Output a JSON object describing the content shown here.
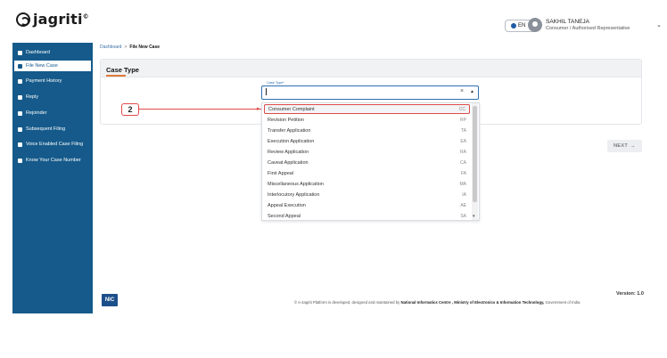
{
  "header": {
    "logo_text": "jagriti",
    "logo_sup": "©",
    "language": "EN",
    "user_name": "SAKHIL TANEJA",
    "user_role": "Consumer / Authorised Representative"
  },
  "sidebar": {
    "items": [
      {
        "label": "Dashboard",
        "icon": "grid-icon"
      },
      {
        "label": "File New Case",
        "icon": "file-icon"
      },
      {
        "label": "Payment History",
        "icon": "card-icon"
      },
      {
        "label": "Reply",
        "icon": "edit-icon"
      },
      {
        "label": "Rejoinder",
        "icon": "file-icon"
      },
      {
        "label": "Subsequent Filing",
        "icon": "file-icon"
      },
      {
        "label": "Voice Enabled Case Filing",
        "icon": "mic-icon"
      },
      {
        "label": "Know Your Case Number",
        "icon": "edit-icon"
      }
    ]
  },
  "breadcrumb": {
    "home": "Dashboard",
    "separator": ">",
    "current": "File New Case"
  },
  "card": {
    "title": "Case Type"
  },
  "select": {
    "label": "Case Type*",
    "value": "",
    "clear_symbol": "×",
    "arrow_symbol": "▲"
  },
  "annotation": {
    "number": "2"
  },
  "dropdown": {
    "options": [
      {
        "label": "Consumer Complaint",
        "code": "CC"
      },
      {
        "label": "Revision Petition",
        "code": "RP"
      },
      {
        "label": "Transfer Application",
        "code": "TA"
      },
      {
        "label": "Execution Application",
        "code": "EA"
      },
      {
        "label": "Review Application",
        "code": "RA"
      },
      {
        "label": "Caveat Application",
        "code": "CA"
      },
      {
        "label": "First Appeal",
        "code": "FA"
      },
      {
        "label": "Miscellaneous Application",
        "code": "MA"
      },
      {
        "label": "Interlocutory Application",
        "code": "IA"
      },
      {
        "label": "Appeal Execution",
        "code": "AE"
      },
      {
        "label": "Second Appeal",
        "code": "SA"
      }
    ]
  },
  "actions": {
    "next_label": "NEXT",
    "next_arrow": "→"
  },
  "footer": {
    "logo": "NIC",
    "version": "Version: 1.0",
    "text_prefix": "© e-Jagriti Platform is developed, designed and maintained by ",
    "text_org": "National Informatics Centre , Ministry of Electronics & Information Technology,",
    "text_suffix": " Government of India"
  },
  "colors": {
    "sidebar_bg": "#155a8a",
    "accent": "#2d6fb5",
    "annotation": "#e04a4a",
    "tab_underline": "#e07a3a"
  }
}
